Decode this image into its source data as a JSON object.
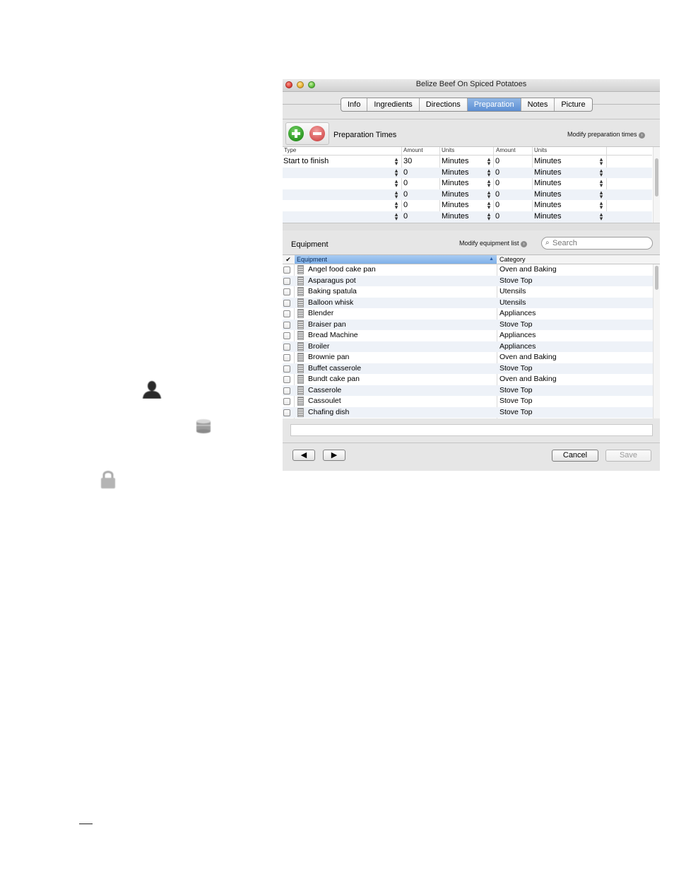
{
  "window": {
    "title": "Belize Beef On Spiced Potatoes"
  },
  "tabs": [
    {
      "label": "Info",
      "active": false
    },
    {
      "label": "Ingredients",
      "active": false
    },
    {
      "label": "Directions",
      "active": false
    },
    {
      "label": "Preparation",
      "active": true
    },
    {
      "label": "Notes",
      "active": false
    },
    {
      "label": "Picture",
      "active": false
    }
  ],
  "preparation": {
    "title": "Preparation Times",
    "modify_label": "Modify preparation times",
    "columns": [
      "Type",
      "Amount",
      "Units",
      "Amount",
      "Units"
    ],
    "rows": [
      {
        "type": "Start to finish",
        "amount1": "30",
        "units1": "Minutes",
        "amount2": "0",
        "units2": "Minutes"
      },
      {
        "type": "",
        "amount1": "0",
        "units1": "Minutes",
        "amount2": "0",
        "units2": "Minutes"
      },
      {
        "type": "",
        "amount1": "0",
        "units1": "Minutes",
        "amount2": "0",
        "units2": "Minutes"
      },
      {
        "type": "",
        "amount1": "0",
        "units1": "Minutes",
        "amount2": "0",
        "units2": "Minutes"
      },
      {
        "type": "",
        "amount1": "0",
        "units1": "Minutes",
        "amount2": "0",
        "units2": "Minutes"
      },
      {
        "type": "",
        "amount1": "0",
        "units1": "Minutes",
        "amount2": "0",
        "units2": "Minutes"
      }
    ]
  },
  "equipment": {
    "title": "Equipment",
    "modify_label": "Modify equipment list",
    "search_placeholder": "Search",
    "columns": {
      "check": "✔",
      "name": "Equipment",
      "category": "Category"
    },
    "items": [
      {
        "name": "Angel food cake pan",
        "category": "Oven and Baking",
        "checked": false
      },
      {
        "name": "Asparagus pot",
        "category": "Stove Top",
        "checked": false
      },
      {
        "name": "Baking spatula",
        "category": "Utensils",
        "checked": false
      },
      {
        "name": "Balloon whisk",
        "category": "Utensils",
        "checked": false
      },
      {
        "name": "Blender",
        "category": "Appliances",
        "checked": false
      },
      {
        "name": "Braiser pan",
        "category": "Stove Top",
        "checked": false
      },
      {
        "name": "Bread Machine",
        "category": "Appliances",
        "checked": false
      },
      {
        "name": "Broiler",
        "category": "Appliances",
        "checked": false
      },
      {
        "name": "Brownie pan",
        "category": "Oven and Baking",
        "checked": false
      },
      {
        "name": "Buffet casserole",
        "category": "Stove Top",
        "checked": false
      },
      {
        "name": "Bundt cake pan",
        "category": "Oven and Baking",
        "checked": false
      },
      {
        "name": "Casserole",
        "category": "Stove Top",
        "checked": false
      },
      {
        "name": "Cassoulet",
        "category": "Stove Top",
        "checked": false
      },
      {
        "name": "Chafing dish",
        "category": "Stove Top",
        "checked": false
      }
    ]
  },
  "footer": {
    "prev_icon": "◀",
    "next_icon": "▶",
    "cancel_label": "Cancel",
    "save_label": "Save"
  },
  "icons": {
    "person": "person-icon",
    "database": "database-icon",
    "lock": "lock-icon"
  },
  "colors": {
    "active_tab": "#5d8fd4",
    "add_button": "#2f9a25",
    "remove_button": "#d85a5a",
    "row_stripe": "#eef2f8"
  }
}
